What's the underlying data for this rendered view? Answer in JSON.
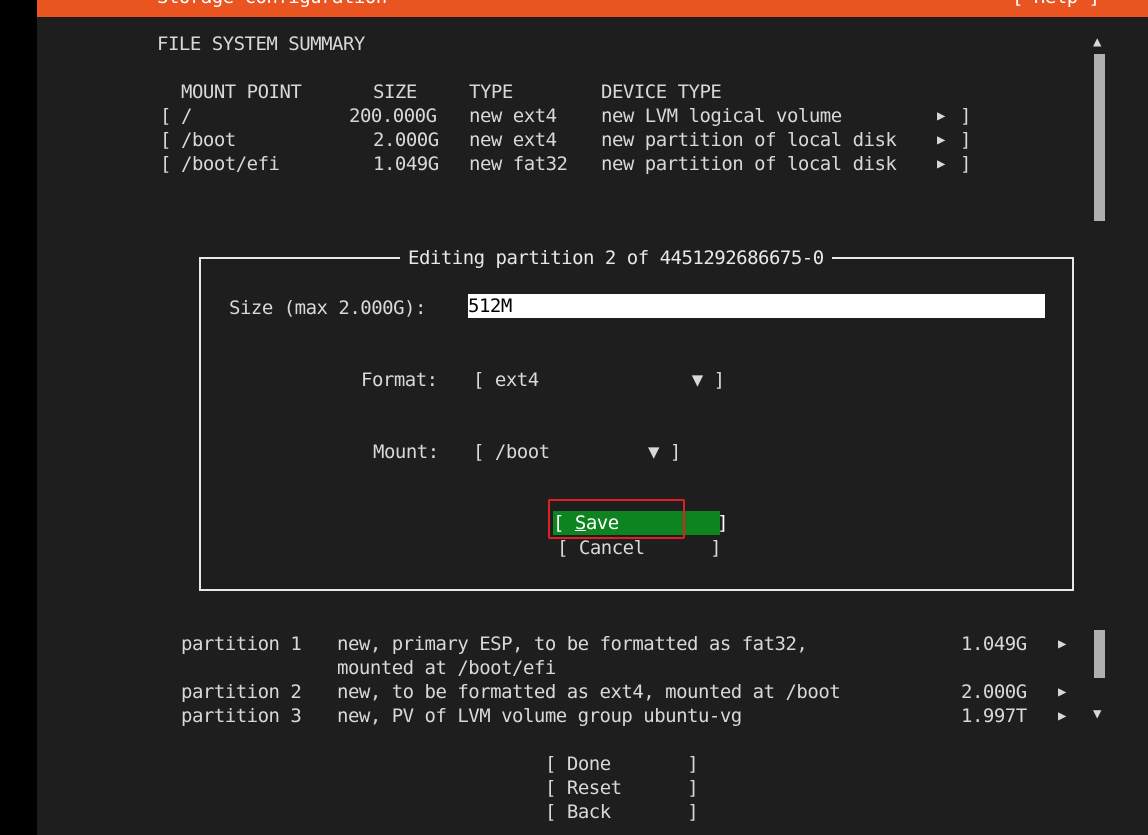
{
  "header": {
    "title": "Storage configuration",
    "help": "[ Help ]"
  },
  "summary": {
    "title": "FILE SYSTEM SUMMARY",
    "columns": [
      "MOUNT POINT",
      "SIZE",
      "TYPE",
      "DEVICE TYPE"
    ],
    "rows": [
      {
        "open": "[",
        "mount": "/",
        "size": "200.000G",
        "type": "new ext4",
        "device": "new LVM logical volume",
        "arrow": "▶",
        "close": "]"
      },
      {
        "open": "[",
        "mount": "/boot",
        "size": "2.000G",
        "type": "new ext4",
        "device": "new partition of local disk",
        "arrow": "▶",
        "close": "]"
      },
      {
        "open": "[",
        "mount": "/boot/efi",
        "size": "1.049G",
        "type": "new fat32",
        "device": "new partition of local disk",
        "arrow": "▶",
        "close": "]"
      }
    ]
  },
  "dialog": {
    "title": "Editing partition 2 of 4451292686675-0",
    "size_label": "Size (max 2.000G):",
    "size_value": "512M",
    "format_label": "Format:",
    "format_value": "[ ext4              ▼ ]",
    "mount_label": "Mount:",
    "mount_value": "[ /boot         ▼ ]",
    "save_open": "[ ",
    "save_hotkey": "S",
    "save_rest": "ave         ]",
    "cancel": "[ Cancel      ]"
  },
  "partitions": [
    {
      "label": "partition 1",
      "desc": "new, primary ESP, to be formatted as fat32,",
      "desc2": "mounted at /boot/efi",
      "size": "1.049G",
      "arrow": "▶"
    },
    {
      "label": "partition 2",
      "desc": "new, to be formatted as ext4, mounted at /boot",
      "size": "2.000G",
      "arrow": "▶"
    },
    {
      "label": "partition 3",
      "desc": "new, PV of LVM volume group ubuntu-vg",
      "size": "1.997T",
      "arrow": "▶"
    }
  ],
  "actions": {
    "done": "[ Done       ]",
    "reset": "[ Reset      ]",
    "back": "[ Back       ]"
  },
  "scroll": {
    "up": "▲",
    "down": "▼"
  },
  "colors": {
    "header": "#e95420",
    "save_bg": "#0e8420",
    "highlight": "#e02020"
  }
}
